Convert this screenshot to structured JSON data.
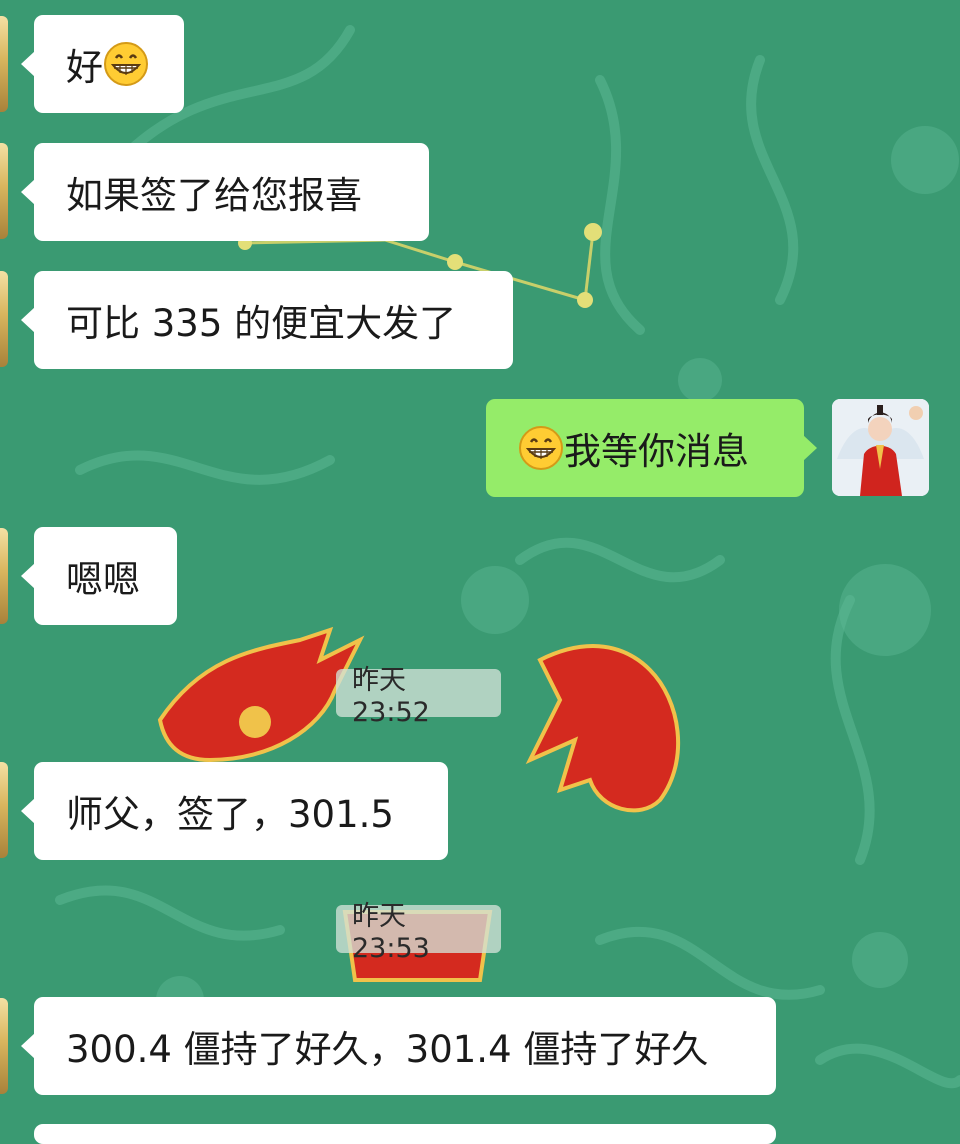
{
  "chat": {
    "messages": [
      {
        "side": "in",
        "text": "好",
        "emoji_after": "grinning-face-emoji"
      },
      {
        "side": "in",
        "text": "如果签了给您报喜"
      },
      {
        "side": "in",
        "text": "可比 335 的便宜大发了"
      },
      {
        "side": "out",
        "text": "我等你消息",
        "emoji_before": "grinning-face-emoji"
      },
      {
        "side": "in",
        "text": "嗯嗯"
      },
      {
        "side": "in",
        "text": "师父，签了，301.5"
      },
      {
        "side": "in",
        "text": "300.4 僵持了好久，301.4 僵持了好久"
      }
    ],
    "timestamps": [
      "昨天 23:52",
      "昨天 23:53"
    ]
  },
  "colors": {
    "wallpaper": "#3a9a72",
    "incoming_bubble": "#ffffff",
    "outgoing_bubble": "#95ec69"
  }
}
